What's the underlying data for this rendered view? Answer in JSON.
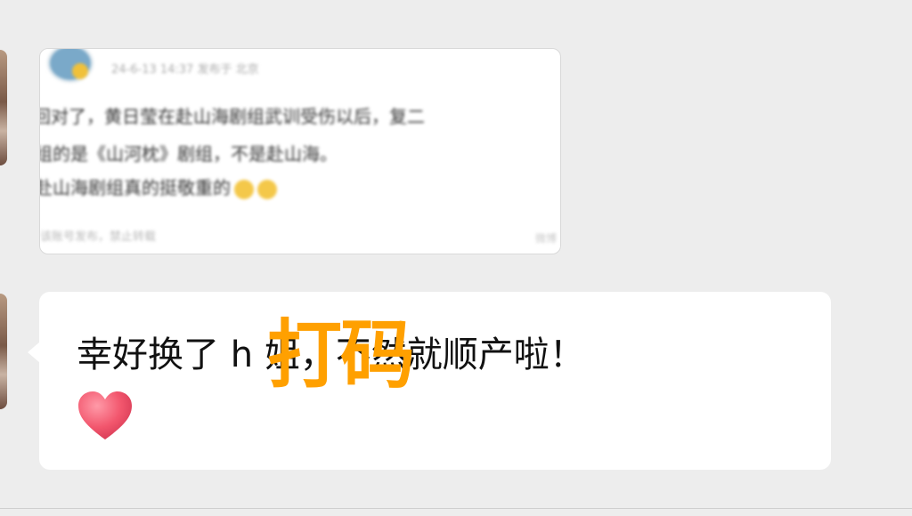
{
  "messages": {
    "image_post": {
      "meta": "24-6-13 14:37  发布于 北京",
      "line1": "回对了，黄日莹在赴山海剧组武训受伤以后，复二",
      "line2": "组的是《山河枕》剧组，不是赴山海。",
      "line3": "赴山海剧组真的挺敬重的",
      "footer_left": "该账号发布，禁止转载",
      "footer_right": "微博"
    },
    "text_message": {
      "text": "幸好换了 h 姐，不然就顺产啦！",
      "emoji": "heart-emoji"
    }
  },
  "overlay": {
    "text": "打码",
    "color": "#ffa000"
  },
  "colors": {
    "background": "#ededed",
    "bubble": "#ffffff",
    "heart": "#f2566d"
  }
}
